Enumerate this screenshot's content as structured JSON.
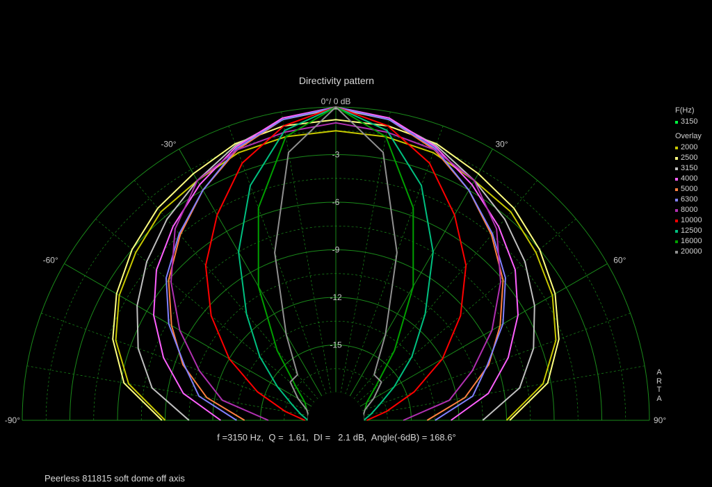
{
  "chart_data": {
    "type": "polar",
    "title": "Directivity pattern",
    "scale": "half-polar",
    "angle_range": [
      -90,
      90
    ],
    "radial_range_db": [
      -18,
      0
    ],
    "radial_ticks": [
      "-3",
      "-6",
      "-9",
      "-12",
      "-15"
    ],
    "angle_labels": {
      "top": "0°/ 0 dB",
      "m30": "-30°",
      "p30": "30°",
      "m60": "-60°",
      "p60": "60°",
      "m90": "-90°",
      "p90": "90°"
    },
    "grid": true,
    "legend_placement": "right",
    "current_header": "F(Hz)",
    "current": {
      "name": "3150",
      "color": "#00ff40"
    },
    "overlay_header": "Overlay",
    "angles": [
      0,
      10,
      20,
      30,
      40,
      50,
      60,
      70,
      80,
      90
    ],
    "series": [
      {
        "name": "2000",
        "color": "#c8c800",
        "db": [
          -1.5,
          -1.6,
          -1.8,
          -2.3,
          -2.6,
          -3.3,
          -4.0,
          -5.0,
          -6.5,
          -9.0
        ]
      },
      {
        "name": "2500",
        "color": "#ffff80",
        "db": [
          -0.8,
          -0.9,
          -1.2,
          -1.8,
          -2.3,
          -3.0,
          -3.8,
          -4.8,
          -6.2,
          -8.8
        ]
      },
      {
        "name": "3150",
        "color": "#c0c0c0",
        "db": [
          -0.1,
          -0.5,
          -1.3,
          -2.3,
          -3.2,
          -4.2,
          -5.3,
          -6.5,
          -8.0,
          -10.5
        ]
      },
      {
        "name": "4000",
        "color": "#ff60ff",
        "db": [
          0.0,
          -0.4,
          -1.4,
          -2.6,
          -3.8,
          -5.0,
          -6.5,
          -8.2,
          -10.0,
          -12.5
        ]
      },
      {
        "name": "5000",
        "color": "#ff8040",
        "db": [
          0.0,
          -0.5,
          -1.6,
          -3.0,
          -4.5,
          -6.0,
          -7.8,
          -9.5,
          -11.5,
          -14.0
        ]
      },
      {
        "name": "6300",
        "color": "#8080ff",
        "db": [
          0.0,
          -0.5,
          -1.5,
          -3.0,
          -4.4,
          -5.8,
          -7.6,
          -9.6,
          -11.0,
          -13.5
        ]
      },
      {
        "name": "8000",
        "color": "#b030b0",
        "db": [
          -1.0,
          -1.3,
          -1.6,
          -2.3,
          -4.0,
          -6.2,
          -8.4,
          -10.6,
          -12.5,
          -15.5
        ]
      },
      {
        "name": "10000",
        "color": "#ff0000",
        "db": [
          0.0,
          -0.9,
          -2.5,
          -4.8,
          -7.0,
          -9.5,
          -12.0,
          -14.5,
          -16.5,
          -17.8
        ]
      },
      {
        "name": "12500",
        "color": "#00c080",
        "db": [
          0.0,
          -1.2,
          -4.0,
          -7.5,
          -11.0,
          -13.5,
          -15.5,
          -16.8,
          -17.5,
          -18.0
        ]
      },
      {
        "name": "16000",
        "color": "#00a000",
        "db": [
          0.0,
          -1.6,
          -5.5,
          -10.0,
          -14.0,
          -16.5,
          -17.5,
          -17.8,
          -18.0,
          -18.0
        ]
      },
      {
        "name": "20000",
        "color": "#909090",
        "db": [
          0.0,
          -2.6,
          -8.5,
          -13.5,
          -16.0,
          -16.0,
          -17.0,
          -17.8,
          -18.0,
          -18.0
        ]
      }
    ]
  },
  "stats_text": "f =3150 Hz,  Q =  1.61,  DI =   2.1 dB,  Angle(-6dB) = 168.6°",
  "caption": "Peerless 811815 soft dome off axis",
  "watermark": [
    "A",
    "R",
    "T",
    "A"
  ]
}
